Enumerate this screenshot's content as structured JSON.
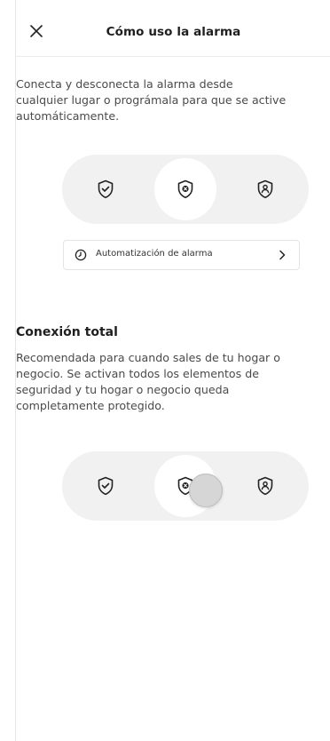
{
  "header": {
    "title": "Cómo uso la alarma",
    "close_icon": "close-icon"
  },
  "intro": {
    "lines": [
      "Conecta y desconecta la alarma desde",
      "cualquier lugar o prográmala para que se active",
      "automáticamente."
    ]
  },
  "mode_selector": {
    "modes": [
      {
        "icon": "shield-check-icon"
      },
      {
        "icon": "shield-x-icon",
        "selected": true
      },
      {
        "icon": "shield-person-icon"
      }
    ]
  },
  "automation": {
    "label": "Automatización de alarma",
    "icon": "clock-icon",
    "chevron": "chevron-right-icon"
  },
  "section": {
    "title": "Conexión total",
    "lines": [
      "Recomendada para cuando sales de tu hogar o",
      "negocio. Se activan todos los elementos de",
      "seguridad y tu hogar o negocio queda",
      "completamente protegido."
    ]
  },
  "colors": {
    "track": "#f1f1f1",
    "text": "#4a4a4a",
    "title": "#1f1f1f"
  }
}
